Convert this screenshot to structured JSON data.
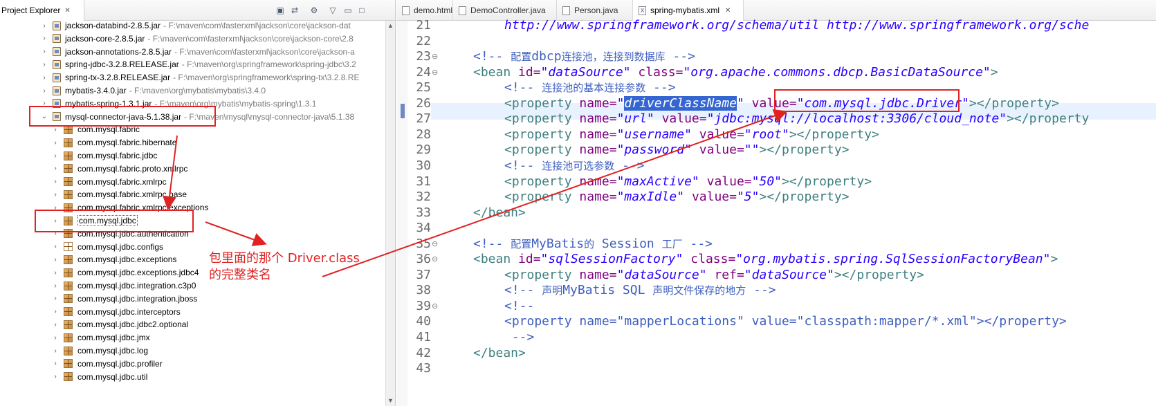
{
  "explorer": {
    "tab_label": "Project Explorer",
    "close_glyph": "✕",
    "toolbar_icons": [
      "collapse-all-icon",
      "link-editor-icon",
      "filters-icon",
      "view-menu-icon",
      "minimize-icon",
      "maximize-icon"
    ],
    "jar_rows": [
      {
        "name": "jackson-databind-2.8.5.jar",
        "path": "- F:\\maven\\com\\fasterxml\\jackson\\core\\jackson-dat"
      },
      {
        "name": "jackson-core-2.8.5.jar",
        "path": "- F:\\maven\\com\\fasterxml\\jackson\\core\\jackson-core\\2.8"
      },
      {
        "name": "jackson-annotations-2.8.5.jar",
        "path": "- F:\\maven\\com\\fasterxml\\jackson\\core\\jackson-a"
      },
      {
        "name": "spring-jdbc-3.2.8.RELEASE.jar",
        "path": "- F:\\maven\\org\\springframework\\spring-jdbc\\3.2"
      },
      {
        "name": "spring-tx-3.2.8.RELEASE.jar",
        "path": "- F:\\maven\\org\\springframework\\spring-tx\\3.2.8.RE"
      },
      {
        "name": "mybatis-3.4.0.jar",
        "path": "- F:\\maven\\org\\mybatis\\mybatis\\3.4.0"
      },
      {
        "name": "mybatis-spring-1.3.1.jar",
        "path": "- F:\\maven\\org\\mybatis\\mybatis-spring\\1.3.1"
      },
      {
        "name": "mysql-connector-java-5.1.38.jar",
        "path": "- F:\\maven\\mysql\\mysql-connector-java\\5.1.38"
      }
    ],
    "packages": [
      "com.mysql.fabric",
      "com.mysql.fabric.hibernate",
      "com.mysql.fabric.jdbc",
      "com.mysql.fabric.proto.xmlrpc",
      "com.mysql.fabric.xmlrpc",
      "com.mysql.fabric.xmlrpc.base",
      "com.mysql.fabric.xmlrpc.exceptions",
      "com.mysql.jdbc",
      "com.mysql.jdbc.authentication",
      "com.mysql.jdbc.configs",
      "com.mysql.jdbc.exceptions",
      "com.mysql.jdbc.exceptions.jdbc4",
      "com.mysql.jdbc.integration.c3p0",
      "com.mysql.jdbc.integration.jboss",
      "com.mysql.jdbc.interceptors",
      "com.mysql.jdbc.jdbc2.optional",
      "com.mysql.jdbc.jmx",
      "com.mysql.jdbc.log",
      "com.mysql.jdbc.profiler",
      "com.mysql.jdbc.util"
    ]
  },
  "editor": {
    "tabs": [
      {
        "label": "demo.html",
        "icon": "html-file-icon"
      },
      {
        "label": "DemoController.java",
        "icon": "java-file-icon"
      },
      {
        "label": "Person.java",
        "icon": "java-file-icon"
      },
      {
        "label": "spring-mybatis.xml",
        "icon": "xml-file-icon",
        "active": true
      }
    ],
    "close_glyph": "✕",
    "line_numbers": [
      "21",
      "22",
      "23",
      "24",
      "25",
      "26",
      "27",
      "28",
      "29",
      "30",
      "31",
      "32",
      "33",
      "34",
      "35",
      "36",
      "37",
      "38",
      "39",
      "40",
      "41",
      "42",
      "43"
    ],
    "fold_marks": {
      "23": "⊖",
      "24": "⊖",
      "35": "⊖",
      "36": "⊖",
      "39": "⊖"
    },
    "lines": [
      {
        "indent": 2,
        "tokens": [
          {
            "t": "http://www.springframework.org/schema/util http://www.springframework.org/sche",
            "c": "t-str"
          }
        ]
      },
      {
        "indent": 0,
        "tokens": []
      },
      {
        "indent": 1,
        "tokens": [
          {
            "t": "<!-- ",
            "c": "t-com"
          },
          {
            "t": "配置",
            "c": "t-com-cjk"
          },
          {
            "t": "dbcp",
            "c": "t-com"
          },
          {
            "t": "连接池，连接到数据库",
            "c": "t-com-cjk"
          },
          {
            "t": " -->",
            "c": "t-com"
          }
        ]
      },
      {
        "indent": 1,
        "tokens": [
          {
            "t": "<bean ",
            "c": "t-tag"
          },
          {
            "t": "id=",
            "c": "t-attr"
          },
          {
            "t": "\"dataSource\"",
            "c": "t-str"
          },
          {
            "t": " class=",
            "c": "t-attr"
          },
          {
            "t": "\"org.apache.commons.dbcp.BasicDataSource\"",
            "c": "t-str"
          },
          {
            "t": ">",
            "c": "t-tag"
          }
        ]
      },
      {
        "indent": 2,
        "tokens": [
          {
            "t": "<!-- ",
            "c": "t-com"
          },
          {
            "t": "连接池的基本连接参数",
            "c": "t-com-cjk"
          },
          {
            "t": " -->",
            "c": "t-com"
          }
        ]
      },
      {
        "indent": 2,
        "tokens": [
          {
            "t": "<property ",
            "c": "t-tag"
          },
          {
            "t": "name=",
            "c": "t-attr"
          },
          {
            "t": "\"",
            "c": "t-str"
          },
          {
            "t": "driverClassName",
            "c": "t-sel"
          },
          {
            "t": "\"",
            "c": "t-str"
          },
          {
            "t": " value=",
            "c": "t-attr"
          },
          {
            "t": "\"com.mysql.jdbc.Driver\"",
            "c": "t-str"
          },
          {
            "t": "></property>",
            "c": "t-tag"
          }
        ]
      },
      {
        "indent": 2,
        "tokens": [
          {
            "t": "<property ",
            "c": "t-tag"
          },
          {
            "t": "name=",
            "c": "t-attr"
          },
          {
            "t": "\"url\"",
            "c": "t-str"
          },
          {
            "t": " value=",
            "c": "t-attr"
          },
          {
            "t": "\"jdbc:mysql://localhost:3306/cloud_note\"",
            "c": "t-str"
          },
          {
            "t": "></property",
            "c": "t-tag"
          }
        ]
      },
      {
        "indent": 2,
        "tokens": [
          {
            "t": "<property ",
            "c": "t-tag"
          },
          {
            "t": "name=",
            "c": "t-attr"
          },
          {
            "t": "\"username\"",
            "c": "t-str"
          },
          {
            "t": " value=",
            "c": "t-attr"
          },
          {
            "t": "\"root\"",
            "c": "t-str"
          },
          {
            "t": "></property>",
            "c": "t-tag"
          }
        ]
      },
      {
        "indent": 2,
        "tokens": [
          {
            "t": "<property ",
            "c": "t-tag"
          },
          {
            "t": "name=",
            "c": "t-attr"
          },
          {
            "t": "\"password\"",
            "c": "t-str"
          },
          {
            "t": " value=",
            "c": "t-attr"
          },
          {
            "t": "\"\"",
            "c": "t-str"
          },
          {
            "t": "></property>",
            "c": "t-tag"
          }
        ]
      },
      {
        "indent": 2,
        "tokens": [
          {
            "t": "<!-- ",
            "c": "t-com"
          },
          {
            "t": "连接池可选参数",
            "c": "t-com-cjk"
          },
          {
            "t": " -->",
            "c": "t-com"
          }
        ]
      },
      {
        "indent": 2,
        "tokens": [
          {
            "t": "<property ",
            "c": "t-tag"
          },
          {
            "t": "name=",
            "c": "t-attr"
          },
          {
            "t": "\"maxActive\"",
            "c": "t-str"
          },
          {
            "t": " value=",
            "c": "t-attr"
          },
          {
            "t": "\"50\"",
            "c": "t-str"
          },
          {
            "t": "></property>",
            "c": "t-tag"
          }
        ]
      },
      {
        "indent": 2,
        "tokens": [
          {
            "t": "<property ",
            "c": "t-tag"
          },
          {
            "t": "name=",
            "c": "t-attr"
          },
          {
            "t": "\"maxIdle\"",
            "c": "t-str"
          },
          {
            "t": " value=",
            "c": "t-attr"
          },
          {
            "t": "\"5\"",
            "c": "t-str"
          },
          {
            "t": "></property>",
            "c": "t-tag"
          }
        ]
      },
      {
        "indent": 1,
        "tokens": [
          {
            "t": "</bean>",
            "c": "t-tag"
          }
        ]
      },
      {
        "indent": 0,
        "tokens": []
      },
      {
        "indent": 1,
        "tokens": [
          {
            "t": "<!-- ",
            "c": "t-com"
          },
          {
            "t": "配置",
            "c": "t-com-cjk"
          },
          {
            "t": "MyBatis",
            "c": "t-com"
          },
          {
            "t": "的",
            "c": "t-com-cjk"
          },
          {
            "t": " Session ",
            "c": "t-com"
          },
          {
            "t": "工厂",
            "c": "t-com-cjk"
          },
          {
            "t": " -->",
            "c": "t-com"
          }
        ]
      },
      {
        "indent": 1,
        "tokens": [
          {
            "t": "<bean ",
            "c": "t-tag"
          },
          {
            "t": "id=",
            "c": "t-attr"
          },
          {
            "t": "\"sqlSessionFactory\"",
            "c": "t-str"
          },
          {
            "t": " class=",
            "c": "t-attr"
          },
          {
            "t": "\"org.mybatis.spring.SqlSessionFactoryBean\"",
            "c": "t-str"
          },
          {
            "t": ">",
            "c": "t-tag"
          }
        ]
      },
      {
        "indent": 2,
        "tokens": [
          {
            "t": "<property ",
            "c": "t-tag"
          },
          {
            "t": "name=",
            "c": "t-attr"
          },
          {
            "t": "\"dataSource\"",
            "c": "t-str"
          },
          {
            "t": " ref=",
            "c": "t-attr"
          },
          {
            "t": "\"dataSource\"",
            "c": "t-str"
          },
          {
            "t": "></property>",
            "c": "t-tag"
          }
        ]
      },
      {
        "indent": 2,
        "tokens": [
          {
            "t": "<!-- ",
            "c": "t-com"
          },
          {
            "t": "声明",
            "c": "t-com-cjk"
          },
          {
            "t": "MyBatis SQL ",
            "c": "t-com"
          },
          {
            "t": "声明文件保存的地方",
            "c": "t-com-cjk"
          },
          {
            "t": " -->",
            "c": "t-com"
          }
        ]
      },
      {
        "indent": 2,
        "tokens": [
          {
            "t": "<!--",
            "c": "t-com"
          }
        ]
      },
      {
        "indent": 2,
        "tokens": [
          {
            "t": "<property name=\"mapperLocations\" value=\"classpath:mapper/*.xml\"></property>",
            "c": "t-com"
          }
        ]
      },
      {
        "indent": 2,
        "tokens": [
          {
            "t": " -->",
            "c": "t-com"
          }
        ]
      },
      {
        "indent": 1,
        "tokens": [
          {
            "t": "</bean>",
            "c": "t-tag"
          }
        ]
      },
      {
        "indent": 0,
        "tokens": []
      }
    ]
  },
  "annotation": {
    "line1": "包里面的那个 Driver.class",
    "line2": "的完整类名",
    "color": "#e02222"
  }
}
